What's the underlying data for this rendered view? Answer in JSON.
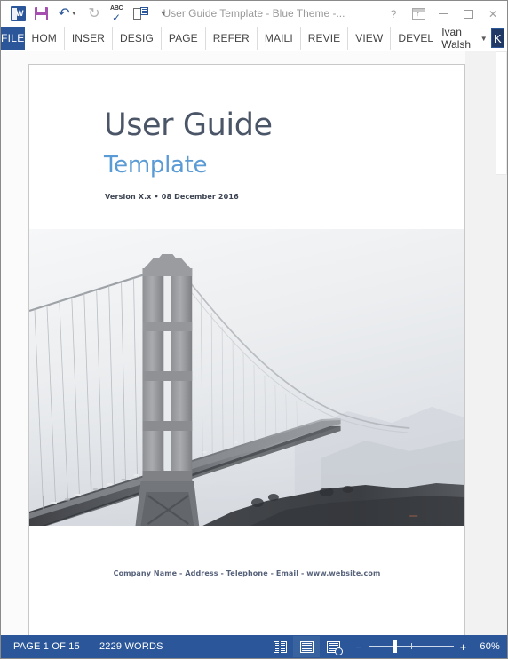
{
  "window": {
    "title": "User Guide Template - Blue Theme -...",
    "help_label": "?",
    "ribbon_options_label": "Ribbon Display Options",
    "minimize_label": "Minimize",
    "maximize_label": "Restore Down",
    "close_label": "✕"
  },
  "quick_access": {
    "word_logo_label": "W",
    "items": [
      {
        "name": "save",
        "label": "Save"
      },
      {
        "name": "undo",
        "label": "Undo"
      },
      {
        "name": "redo",
        "label": "Repeat"
      },
      {
        "name": "spelling",
        "label": "ABC"
      },
      {
        "name": "print-preview",
        "label": "Print Preview and Print"
      },
      {
        "name": "customize",
        "label": "Customize Quick Access Toolbar"
      }
    ]
  },
  "ribbon": {
    "file_tab": "FILE",
    "tabs": [
      "HOM",
      "INSER",
      "DESIG",
      "PAGE",
      "REFER",
      "MAILI",
      "REVIE",
      "VIEW",
      "DEVEL"
    ],
    "account_name": "Ivan Walsh",
    "avatar_initial": "K"
  },
  "document": {
    "title": "User Guide",
    "subtitle": "Template",
    "version_line": "Version X.x • 08 December 2016",
    "footer": "Company Name - Address - Telephone - Email - www.website.com",
    "cover_image_alt": "Golden Gate Bridge in fog, grayscale"
  },
  "status_bar": {
    "page_label": "PAGE 1 OF 15",
    "word_count": "2229 WORDS",
    "views": [
      {
        "name": "read-mode",
        "label": "Read Mode",
        "active": false
      },
      {
        "name": "print-layout",
        "label": "Print Layout",
        "active": true
      },
      {
        "name": "web-layout",
        "label": "Web Layout",
        "active": false
      }
    ],
    "zoom_out_label": "−",
    "zoom_in_label": "+",
    "zoom_level": "60%"
  },
  "colors": {
    "word_blue": "#2b579a",
    "title_slate": "#4b5568",
    "subtitle_blue": "#5b9bd5",
    "save_purple": "#a74fb0",
    "avatar_navy": "#1f3864"
  }
}
